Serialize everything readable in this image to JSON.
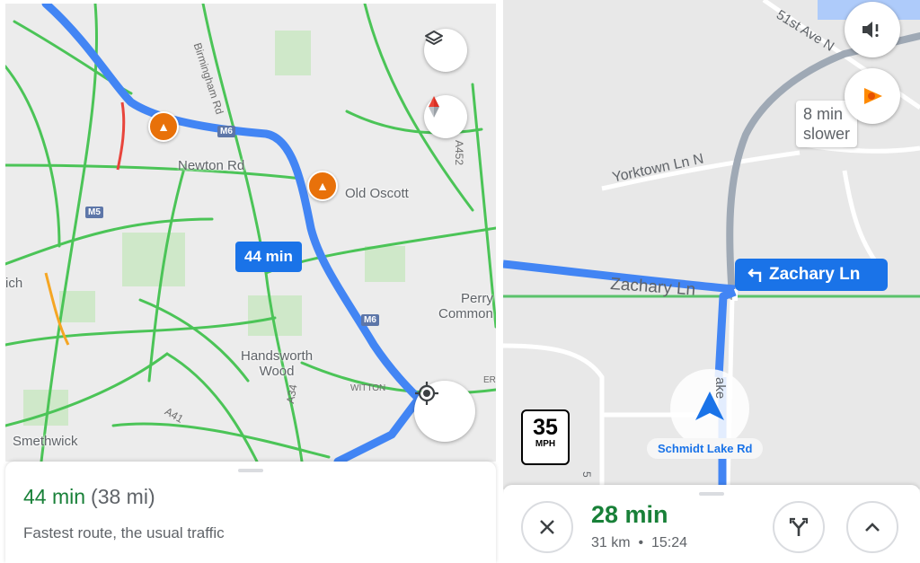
{
  "left": {
    "map": {
      "labels": {
        "newton_rd": "Newton Rd",
        "old_oscott": "Old Oscott",
        "birmingham_rd": "Birmingham Rd",
        "perry_common": "Perry\nCommon",
        "handsworth_wood": "Handsworth\nWood",
        "smethwick": "Smethwick",
        "witton": "WITTON",
        "a452": "A452",
        "a34": "A34",
        "a41": "A41",
        "m6_top": "M6",
        "m6_mid": "M6",
        "m5": "M5",
        "ich": "ich",
        "er": "ER"
      },
      "route_badge": "44 min"
    },
    "controls": {
      "layers_icon": "layers-icon",
      "compass_icon": "compass-icon",
      "locate_icon": "my-location-icon"
    },
    "sheet": {
      "eta": "44 min",
      "distance": "(38 mi)",
      "description": "Fastest route, the usual traffic"
    }
  },
  "right": {
    "map": {
      "labels": {
        "fifty_first": "51st Ave N",
        "yorktown": "Yorktown Ln N",
        "zachary": "Zachary Ln",
        "lake": "ake",
        "five": "5"
      },
      "slower_chip": "8 min\nslower",
      "nav_banner": "Zachary Ln",
      "street_pill": "Schmidt Lake Rd",
      "speed_limit": {
        "value": "35",
        "unit": "MPH"
      }
    },
    "sheet": {
      "eta": "28 min",
      "distance": "31 km",
      "arrival": "15:24"
    }
  },
  "colors": {
    "route": "#4285f4",
    "traffic_green": "#34c759",
    "eta_green": "#188038",
    "camera": "#e8710a"
  }
}
